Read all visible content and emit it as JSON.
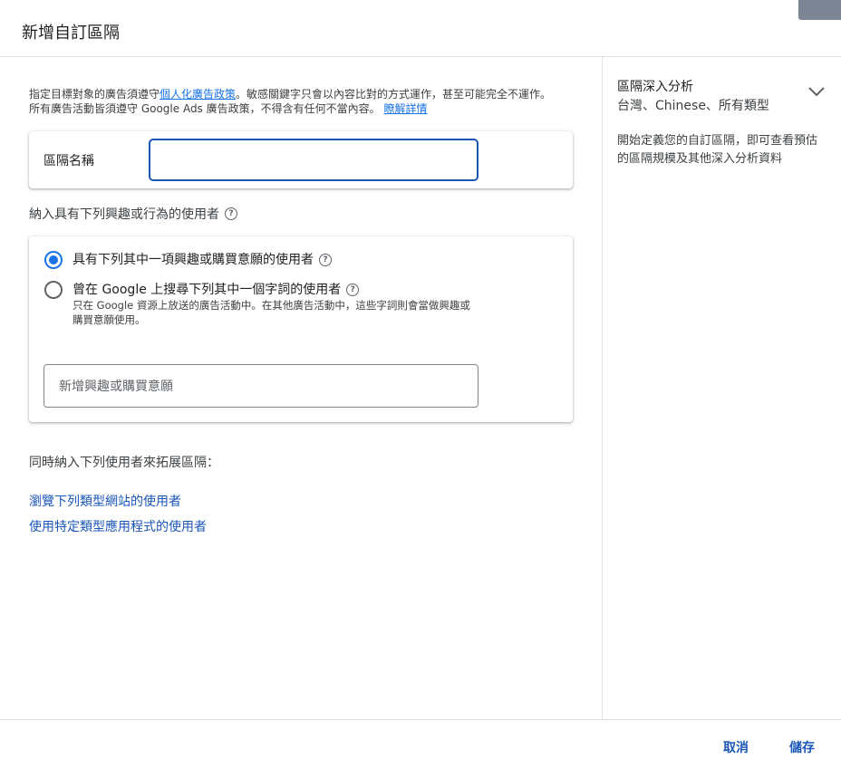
{
  "dialog": {
    "title": "新增自訂區隔"
  },
  "policy": {
    "text_before": "指定目標對象的廣告須遵守",
    "link_policy": "個人化廣告政策",
    "text_after": "。敏感關鍵字只會以內容比對的方式運作，甚至可能完全不運作。所有廣告活動皆須遵守 Google Ads 廣告政策，不得含有任何不當內容。",
    "link_learn": "瞭解詳情"
  },
  "segment_name": {
    "label": "區隔名稱",
    "value": ""
  },
  "include": {
    "heading": "納入具有下列興趣或行為的使用者",
    "options": [
      {
        "label": "具有下列其中一項興趣或購買意願的使用者",
        "checked": true
      },
      {
        "label": "曾在 Google 上搜尋下列其中一個字詞的使用者",
        "checked": false,
        "sub": "只在 Google 資源上放送的廣告活動中。在其他廣告活動中，這些字詞則會當做興趣或購買意願使用。"
      }
    ],
    "input_placeholder": "新增興趣或購買意願"
  },
  "expand": {
    "heading": "同時納入下列使用者來拓展區隔：",
    "links": [
      "瀏覽下列類型網站的使用者",
      "使用特定類型應用程式的使用者"
    ]
  },
  "side": {
    "title": "區隔深入分析",
    "subtitle": "台灣、Chinese、所有類型",
    "description": "開始定義您的自訂區隔，即可查看預估的區隔規模及其他深入分析資料"
  },
  "footer": {
    "cancel": "取消",
    "save": "儲存"
  },
  "colors": {
    "accent": "#1a73e8",
    "link": "#1a56b8",
    "divider": "#e0e0e0"
  }
}
